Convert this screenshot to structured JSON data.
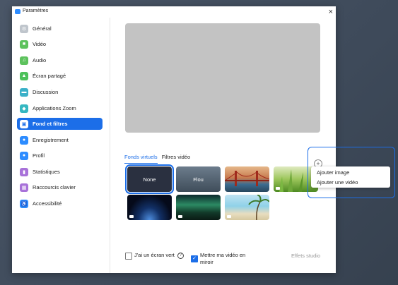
{
  "window": {
    "title": "Paramètres"
  },
  "sidebar": {
    "items": [
      {
        "label": "Général",
        "icon": "gear-icon",
        "color": "#bfc5cc",
        "glyph": "⚙"
      },
      {
        "label": "Vidéo",
        "icon": "video-icon",
        "color": "#5dc25d",
        "glyph": "■"
      },
      {
        "label": "Audio",
        "icon": "headphones-icon",
        "color": "#5dc25d",
        "glyph": "♫"
      },
      {
        "label": "Écran partagé",
        "icon": "share-screen-icon",
        "color": "#4cc15a",
        "glyph": "▲"
      },
      {
        "label": "Discussion",
        "icon": "chat-icon",
        "color": "#3ab0c8",
        "glyph": "▬"
      },
      {
        "label": "Applications Zoom",
        "icon": "apps-icon",
        "color": "#35b7c1",
        "glyph": "◆"
      },
      {
        "label": "Fond et filtres",
        "icon": "background-icon",
        "color": "#ffffff",
        "glyph": "▣"
      },
      {
        "label": "Enregistrement",
        "icon": "record-icon",
        "color": "#2d8cff",
        "glyph": "●"
      },
      {
        "label": "Profil",
        "icon": "profile-icon",
        "color": "#2d8cff",
        "glyph": "●"
      },
      {
        "label": "Statistiques",
        "icon": "stats-icon",
        "color": "#a872d9",
        "glyph": "▮"
      },
      {
        "label": "Raccourcis clavier",
        "icon": "keyboard-icon",
        "color": "#a872d9",
        "glyph": "▦"
      },
      {
        "label": "Accessibilité",
        "icon": "accessibility-icon",
        "color": "#2d8cff",
        "glyph": "♿"
      }
    ],
    "active_index": 6
  },
  "tabs": [
    {
      "label": "Fonds virtuels"
    },
    {
      "label": "Filtres vidéo"
    }
  ],
  "backgrounds": [
    {
      "label": "None"
    },
    {
      "label": "Flou"
    },
    {
      "label": ""
    },
    {
      "label": ""
    },
    {
      "label": ""
    },
    {
      "label": ""
    },
    {
      "label": ""
    }
  ],
  "add_menu": {
    "add_icon": "plus-circle-icon",
    "items": [
      {
        "label": "Ajouter image"
      },
      {
        "label": "Ajouter une vidéo"
      }
    ]
  },
  "options": {
    "green_screen": "J'ai un écran vert",
    "mirror_line1": "Mettre ma vidéo en",
    "mirror_line2": "miroir",
    "studio": "Effets studio"
  },
  "colors": {
    "accent": "#1c6ee8"
  }
}
